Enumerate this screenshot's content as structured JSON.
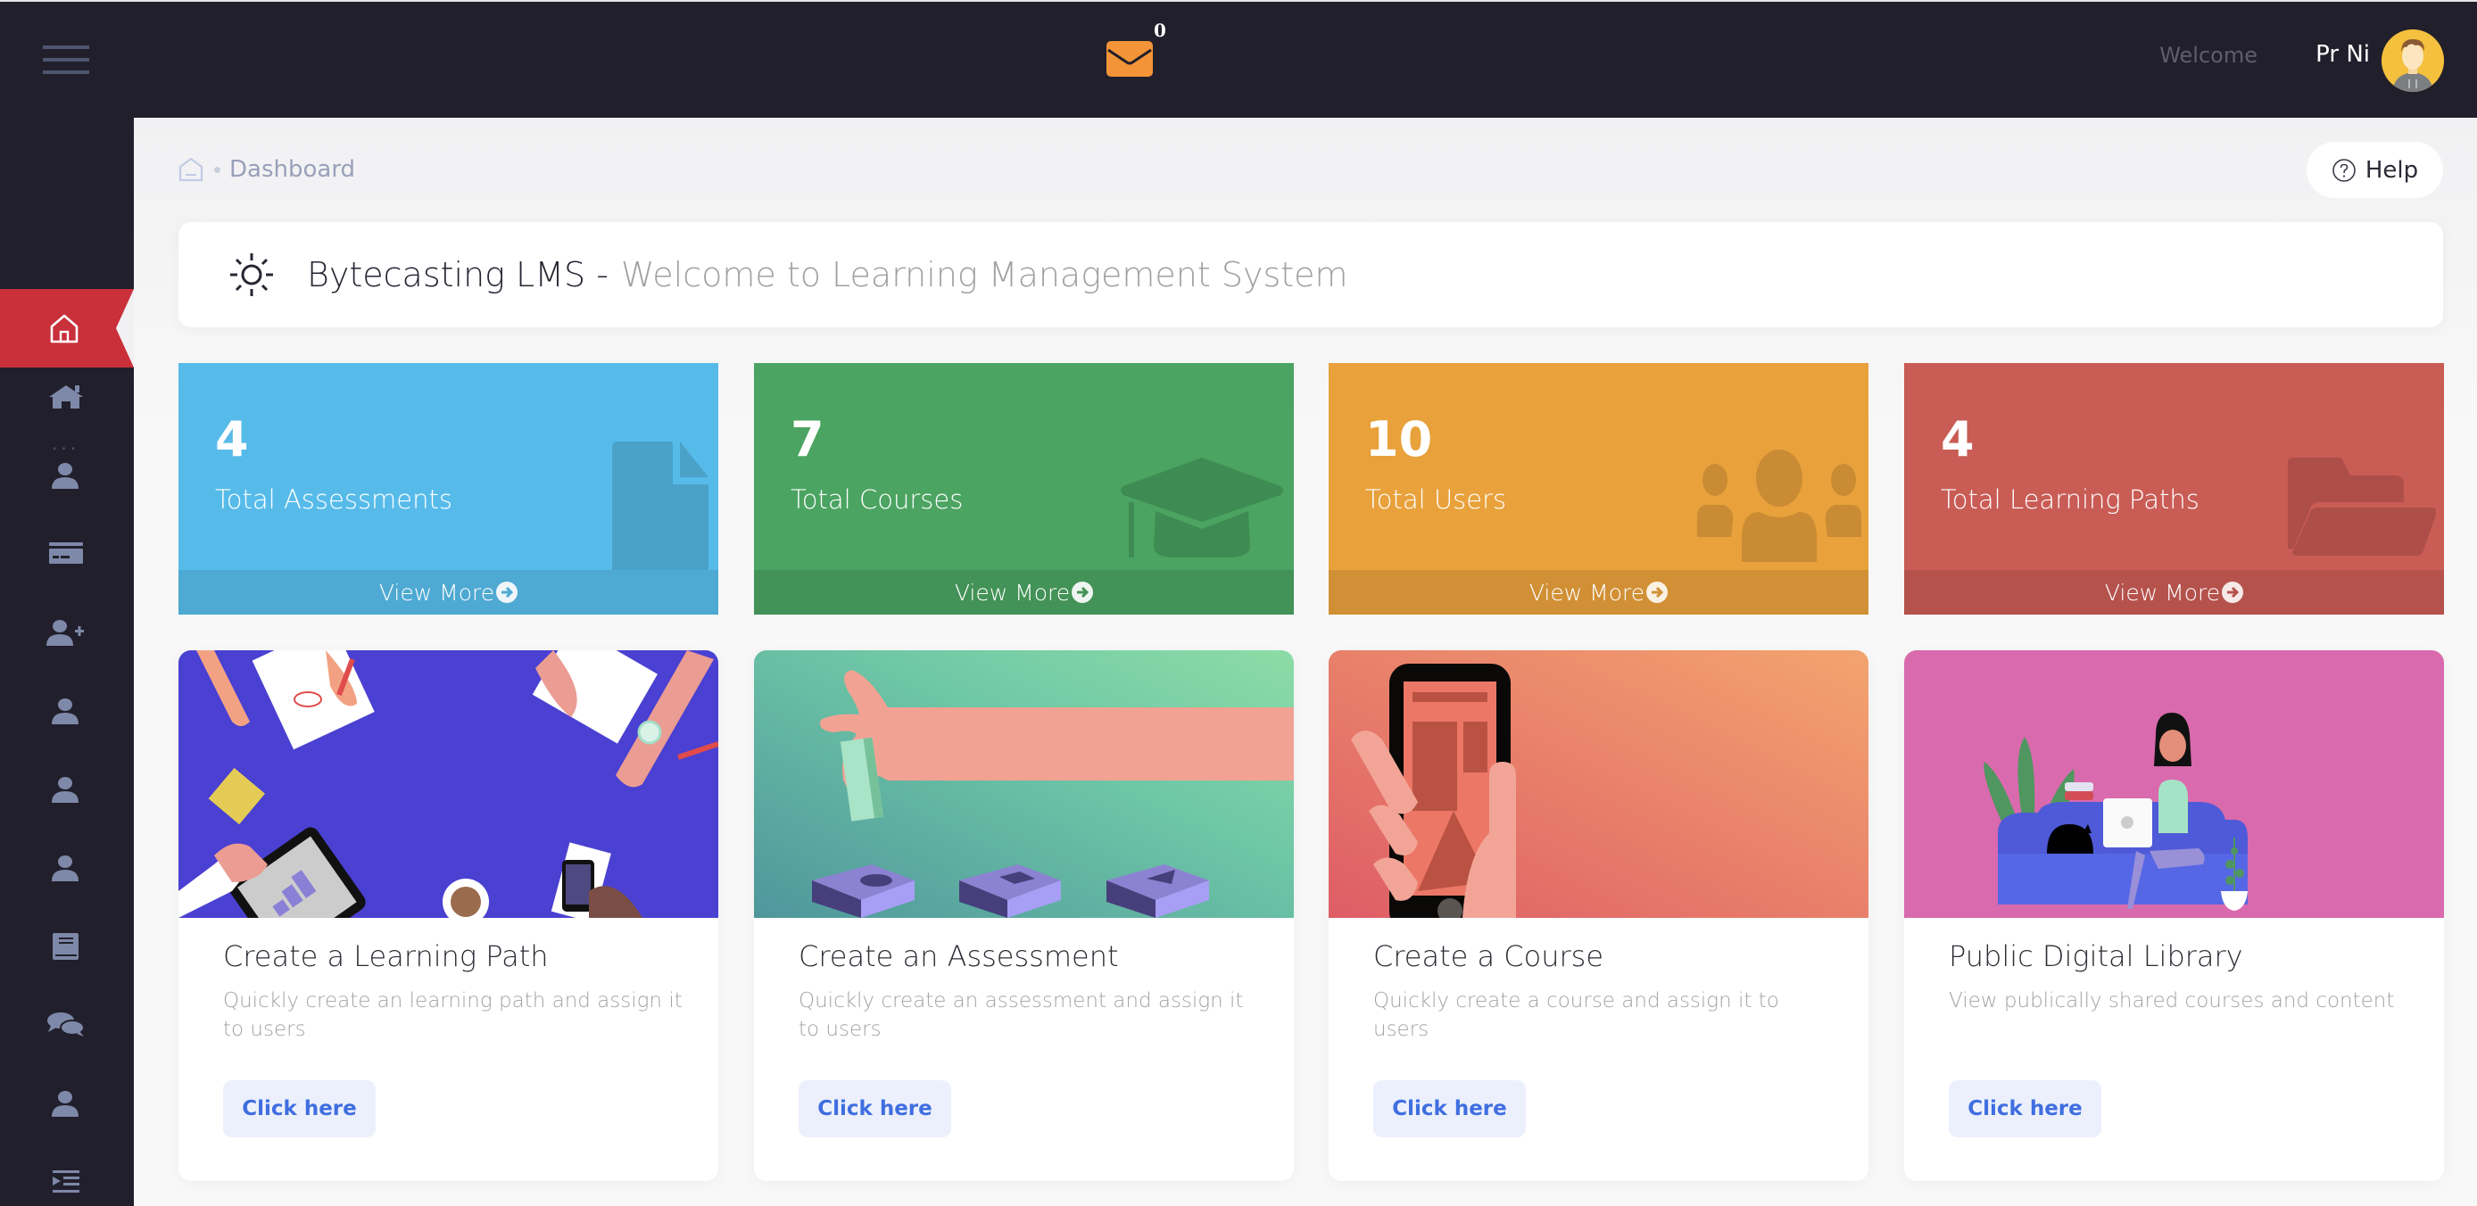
{
  "header": {
    "mail_count": "0",
    "welcome_label": "Welcome",
    "username": "Pr Ni"
  },
  "breadcrumb": {
    "current": "Dashboard"
  },
  "help": {
    "label": "Help"
  },
  "banner": {
    "title": "Bytecasting LMS -",
    "subtitle": "Welcome to Learning Management System"
  },
  "sidebar": {
    "more_label": "...",
    "items": [
      {
        "icon": "home-icon"
      },
      {
        "icon": "user-icon"
      },
      {
        "icon": "credit-card-icon"
      },
      {
        "icon": "user-plus-icon"
      },
      {
        "icon": "user-icon"
      },
      {
        "icon": "user-icon"
      },
      {
        "icon": "user-icon"
      },
      {
        "icon": "book-icon"
      },
      {
        "icon": "comments-icon"
      },
      {
        "icon": "user-icon"
      },
      {
        "icon": "indent-icon"
      }
    ]
  },
  "stats": [
    {
      "value": "4",
      "label": "Total Assessments",
      "more": "View More",
      "color": "#57bbea",
      "footer_color": "#4ea9d3",
      "icon_color": "#4aa2c9"
    },
    {
      "value": "7",
      "label": "Total Courses",
      "more": "View More",
      "color": "#4ba461",
      "footer_color": "#439257",
      "icon_color": "#3e8c53"
    },
    {
      "value": "10",
      "label": "Total Users",
      "more": "View More",
      "color": "#e8a13b",
      "footer_color": "#d19035",
      "icon_color": "#c98b33"
    },
    {
      "value": "4",
      "label": "Total Learning Paths",
      "more": "View More",
      "color": "#c95c55",
      "footer_color": "#b5524c",
      "icon_color": "#ad4e48"
    }
  ],
  "features": [
    {
      "title": "Create a Learning Path",
      "description": "Quickly create an learning path and assign it to users",
      "button": "Click here"
    },
    {
      "title": "Create an Assessment",
      "description": "Quickly create an assessment and assign it to users",
      "button": "Click here"
    },
    {
      "title": "Create a Course",
      "description": "Quickly create a course and assign it to users",
      "button": "Click here"
    },
    {
      "title": "Public Digital Library",
      "description": "View publically shared courses and content",
      "button": "Click here"
    }
  ],
  "colors": {
    "topbar": "#211f2b",
    "active_nav": "#c9303a",
    "mail": "#f29437",
    "link_blue": "#3f6ee0"
  }
}
